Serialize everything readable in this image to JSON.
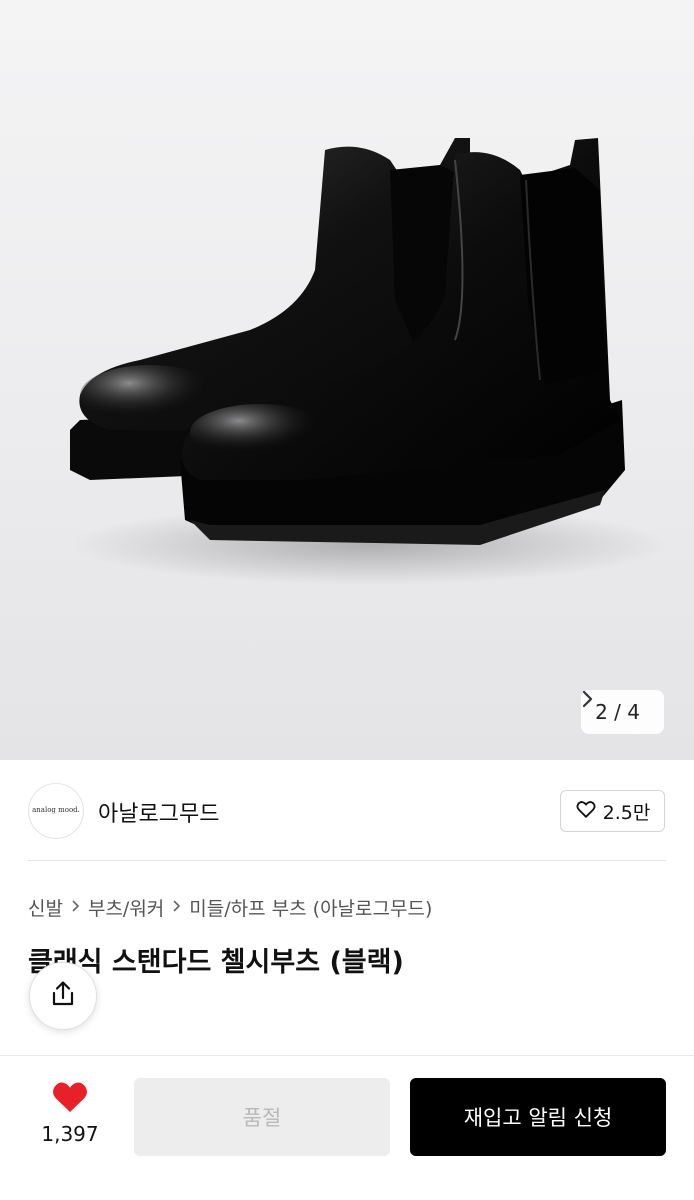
{
  "gallery": {
    "current": "2",
    "separator": "/",
    "total": "4",
    "next_icon": "chevron-right-icon"
  },
  "brand": {
    "logo_text": "analog mood.",
    "name": "아날로그무드",
    "like_icon": "heart-outline-icon",
    "like_count": "2.5만"
  },
  "breadcrumb": {
    "items": [
      "신발",
      "부츠/워커",
      "미들/하프 부츠 (아날로그무드)"
    ],
    "separator_icon": "chevron-right-icon"
  },
  "product": {
    "title": "클래식 스탠다드 첼시부츠 (블랙)"
  },
  "share": {
    "icon": "share-icon"
  },
  "bottom_bar": {
    "wish_icon": "heart-filled-icon",
    "wish_color": "#e8202a",
    "wish_count": "1,397",
    "soldout_label": "품절",
    "restock_label": "재입고 알림 신청"
  }
}
